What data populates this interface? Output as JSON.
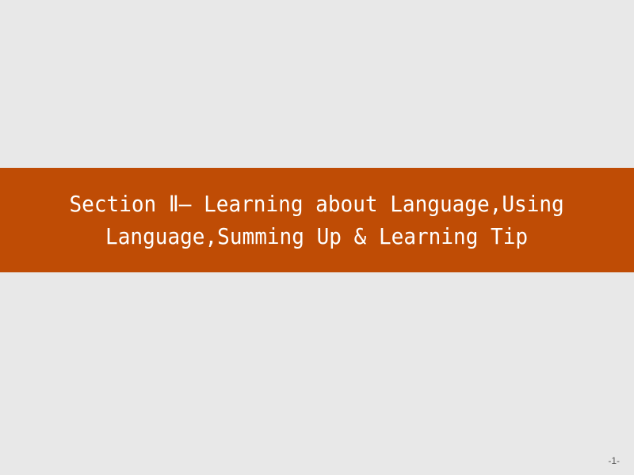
{
  "slide": {
    "title_lines": [
      "Section Ⅱ— Learning about Language,Using",
      "Language,Summing Up & Learning Tip"
    ],
    "page_number": "-1-"
  },
  "colors": {
    "background": "#e8e8e8",
    "banner": "#bf4c05",
    "title_text": "#ffffff"
  }
}
